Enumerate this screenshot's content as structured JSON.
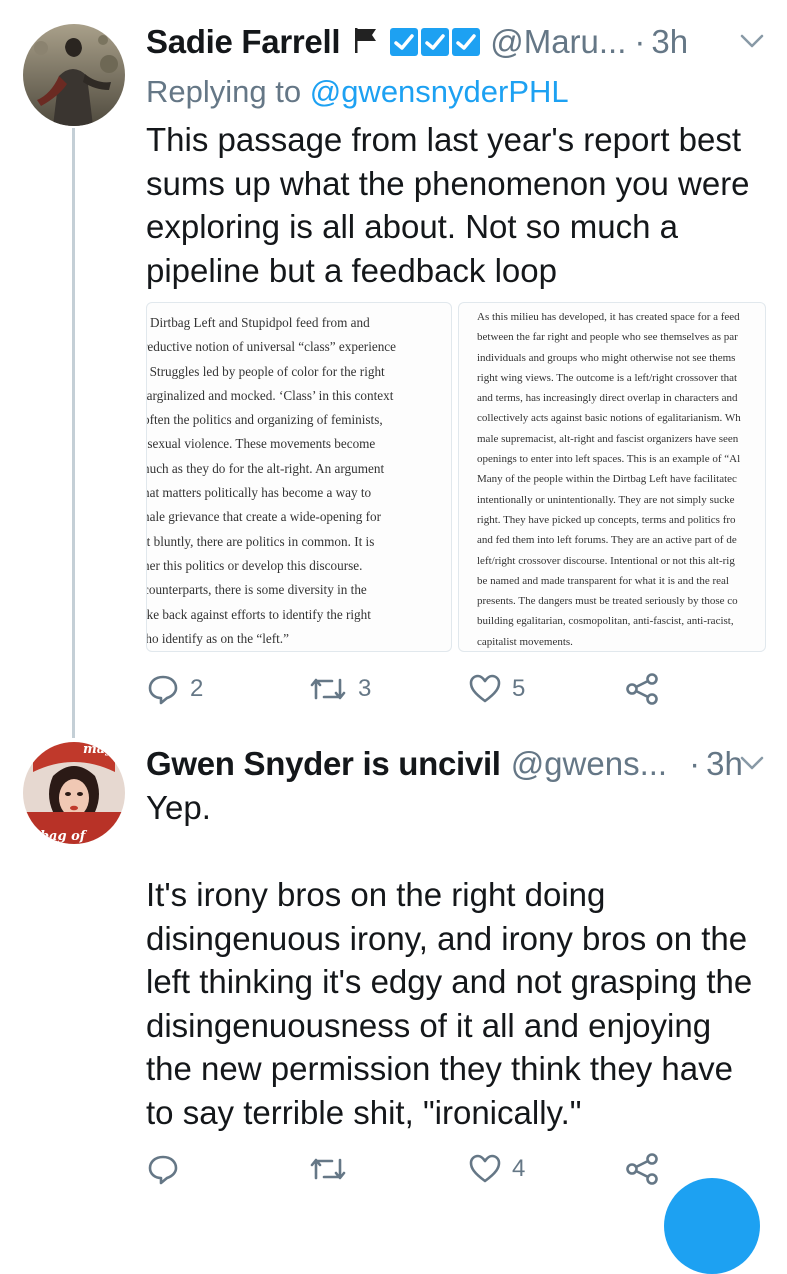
{
  "tweets": [
    {
      "author_name": "Sadie Farrell",
      "handle": "@Maru...",
      "separator": "·",
      "time": "3h",
      "replying_prefix": "Replying to",
      "replying_to": "@gwensnyderPHL",
      "text": "This passage from last year's report best sums up what the phenomenon you were exploring is all about. Not so much a pipeline but a feedback loop",
      "media_left_lines": [
        ": Dirtbag Left and Stupidpol feed from and",
        "reductive notion of universal “class” experience",
        ". Struggles led by people of color for the right",
        "iarginalized and mocked. ‘Class’ in this context",
        "often the politics and organizing of feminists,",
        "‘sexual violence. These movements become",
        "nuch as they do for the alt-right. An argument",
        "hat matters politically has become a way to",
        "nale grievance that create a wide-opening for",
        "it bluntly, there are politics in common. It is",
        "her this politics or develop this discourse.",
        "counterparts, there is some diversity in the",
        "ike back against efforts to identify the right",
        "'ho identify as on the “left.”"
      ],
      "media_right_lines": [
        "As this milieu has developed, it has created space for a feed",
        "between the far right and people who see themselves as par",
        "individuals and groups who might otherwise not see thems",
        "right wing views. The outcome is a left/right crossover that",
        "and terms, has increasingly direct overlap in characters and",
        "collectively acts against basic notions of egalitarianism. Wh",
        "male supremacist, alt-right and fascist organizers have seen",
        "openings to enter into left spaces. This is an example of “Al",
        "Many of the people within the Dirtbag Left have facilitatec",
        "intentionally or unintentionally. They are not simply sucke",
        "right. They have picked up concepts, terms and politics fro",
        "and fed them into left forums. They are an active part of de",
        "left/right crossover discourse. Intentional or not this alt-rig",
        "be named and made transparent for what it is and the real",
        "presents. The dangers must be treated seriously by those co",
        "building egalitarian, cosmopolitan, anti-fascist, anti-racist,",
        "capitalist movements."
      ],
      "reply_count": "2",
      "retweet_count": "3",
      "like_count": "5"
    },
    {
      "author_name": "Gwen Snyder is uncivil",
      "handle": "@gwens...",
      "separator": "·",
      "time": "3h",
      "avatar_text_top": "may",
      "avatar_text_bottom": "a bag of",
      "text": "Yep.\n\nIt's irony bros on the right doing disingenuous irony, and irony bros on the left thinking it's edgy and not grasping the disingenuousness of it all and enjoying the new permission they think they have to say terrible shit, \"ironically.\"",
      "like_count": "4"
    }
  ],
  "colors": {
    "accent": "#1da1f2",
    "secondary_text": "#657786",
    "thread_line": "#c4cfd6"
  },
  "icons": [
    "flag-icon",
    "verified-check-icon",
    "chevron-down-icon",
    "reply-icon",
    "retweet-icon",
    "like-icon",
    "share-icon"
  ]
}
